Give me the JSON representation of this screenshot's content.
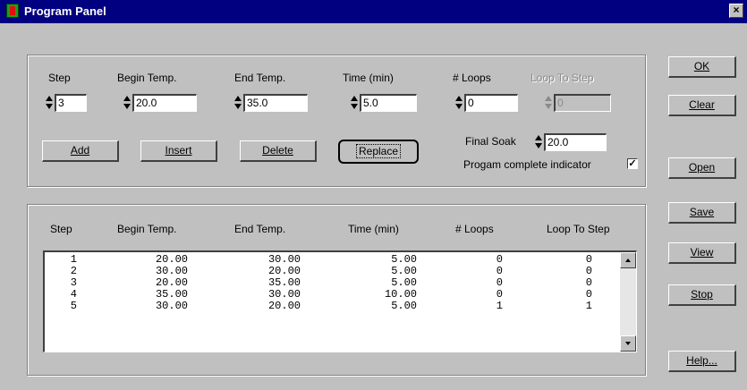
{
  "window": {
    "title": "Program Panel",
    "close_glyph": "×",
    "icon": "app-icon"
  },
  "editor": {
    "labels": {
      "step": "Step",
      "begin_temp": "Begin Temp.",
      "end_temp": "End Temp.",
      "time": "Time (min)",
      "loops": "# Loops",
      "loop_to_step": "Loop To Step"
    },
    "values": {
      "step": "3",
      "begin_temp": "20.0",
      "end_temp": "35.0",
      "time": "5.0",
      "loops": "0",
      "loop_to_step": "0"
    },
    "buttons": {
      "add": "Add",
      "insert": "Insert",
      "delete": "Delete",
      "replace": "Replace"
    },
    "final_soak": {
      "label": "Final Soak",
      "value": "20.0"
    },
    "program_complete": {
      "label": "Progam complete indicator",
      "checked": true,
      "mark": "✓"
    }
  },
  "table": {
    "headers": [
      "Step",
      "Begin Temp.",
      "End Temp.",
      "Time (min)",
      "# Loops",
      "Loop To Step"
    ],
    "rows": [
      [
        "1",
        "20.00",
        "30.00",
        "5.00",
        "0",
        "0"
      ],
      [
        "2",
        "30.00",
        "20.00",
        "5.00",
        "0",
        "0"
      ],
      [
        "3",
        "20.00",
        "35.00",
        "5.00",
        "0",
        "0"
      ],
      [
        "4",
        "35.00",
        "30.00",
        "10.00",
        "0",
        "0"
      ],
      [
        "5",
        "30.00",
        "20.00",
        "5.00",
        "1",
        "1"
      ]
    ]
  },
  "side_buttons": {
    "ok": "OK",
    "clear": "Clear",
    "open": "Open",
    "save": "Save",
    "view": "View",
    "stop": "Stop",
    "help": "Help..."
  }
}
